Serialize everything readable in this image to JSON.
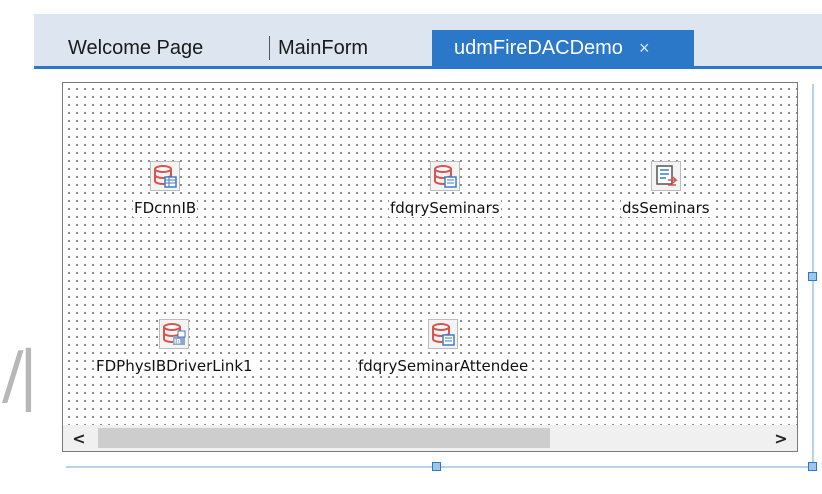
{
  "tabs": [
    {
      "label": "Welcome Page"
    },
    {
      "label": "MainForm"
    },
    {
      "label": "udmFireDACDemo",
      "close": "×"
    }
  ],
  "components": [
    {
      "label": "FDcnnIB",
      "icon": "database-connection-icon"
    },
    {
      "label": "fdqrySeminars",
      "icon": "database-query-icon"
    },
    {
      "label": "dsSeminars",
      "icon": "datasource-icon"
    },
    {
      "label": "FDPhysIBDriverLink1",
      "icon": "ib-driver-link-icon"
    },
    {
      "label": "fdqrySeminarAttendee",
      "icon": "database-query-icon"
    }
  ],
  "scrollbar": {
    "left_arrow": "<",
    "right_arrow": ">"
  },
  "colors": {
    "accent": "#2b78c8",
    "icon_red": "#d9534f",
    "icon_blue": "#3d7ec7",
    "tab_bg": "#dde6f0"
  }
}
